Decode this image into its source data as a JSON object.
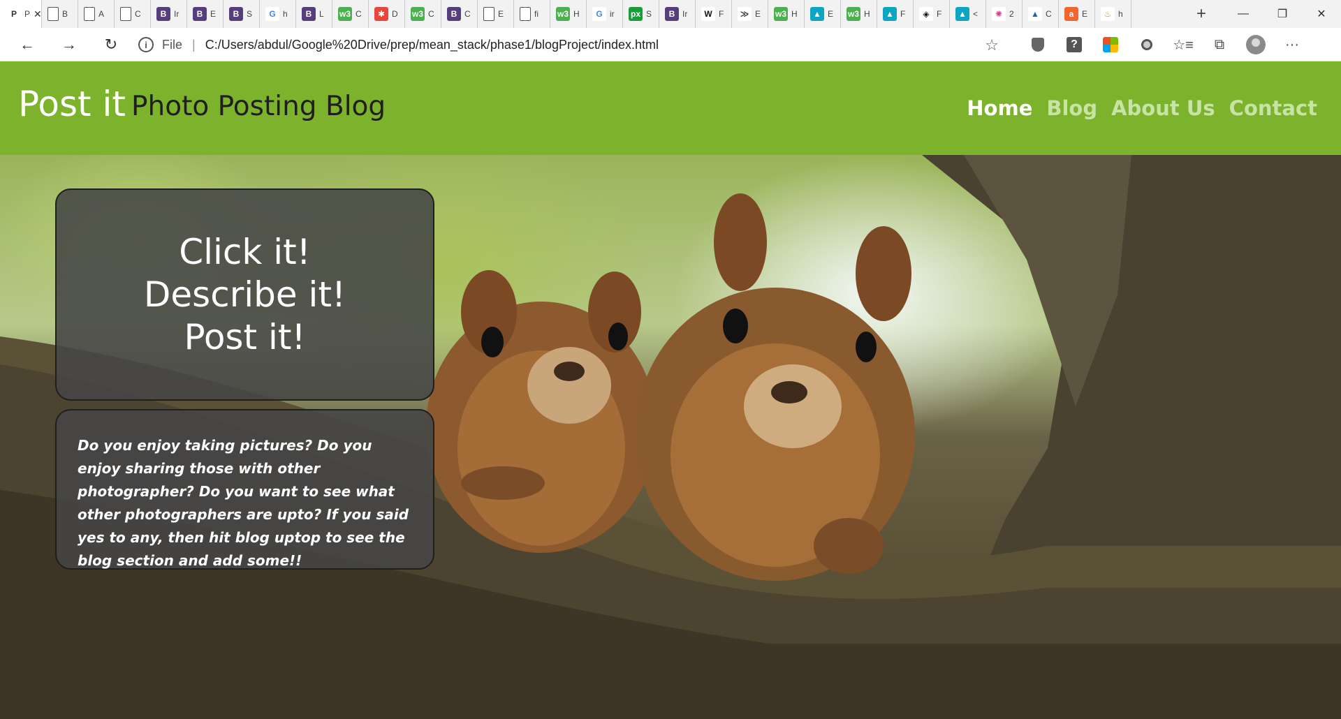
{
  "browser": {
    "tabs": [
      {
        "fav": "P",
        "label": "P",
        "bg": "#ffffff",
        "fg": "#333333",
        "active": true
      },
      {
        "fav": "doc-icon",
        "label": "B"
      },
      {
        "fav": "doc-icon",
        "label": "A"
      },
      {
        "fav": "doc-icon",
        "label": "C"
      },
      {
        "fav": "B",
        "label": "Ir",
        "bg": "#563d7c"
      },
      {
        "fav": "B",
        "label": "E",
        "bg": "#563d7c"
      },
      {
        "fav": "B",
        "label": "S",
        "bg": "#563d7c"
      },
      {
        "fav": "G",
        "label": "h",
        "bg": "#ffffff",
        "fg": "#4285f4"
      },
      {
        "fav": "B",
        "label": "L",
        "bg": "#563d7c"
      },
      {
        "fav": "w3",
        "label": "C",
        "bg": "#4caf50"
      },
      {
        "fav": "✱",
        "label": "D",
        "bg": "#e8453c"
      },
      {
        "fav": "w3",
        "label": "C",
        "bg": "#4caf50"
      },
      {
        "fav": "B",
        "label": "C",
        "bg": "#563d7c"
      },
      {
        "fav": "doc-icon",
        "label": "E"
      },
      {
        "fav": "doc-icon",
        "label": "fi"
      },
      {
        "fav": "w3",
        "label": "H",
        "bg": "#4caf50"
      },
      {
        "fav": "G",
        "label": "ir",
        "bg": "#ffffff",
        "fg": "#4285f4"
      },
      {
        "fav": "px",
        "label": "S",
        "bg": "#1a9c3b"
      },
      {
        "fav": "B",
        "label": "Ir",
        "bg": "#563d7c"
      },
      {
        "fav": "W",
        "label": "F",
        "bg": "#ffffff",
        "fg": "#111111"
      },
      {
        "fav": "≫",
        "label": "E",
        "bg": "#ffffff",
        "fg": "#333333"
      },
      {
        "fav": "w3",
        "label": "H",
        "bg": "#4caf50"
      },
      {
        "fav": "▲",
        "label": "E",
        "bg": "#0ea5c4"
      },
      {
        "fav": "w3",
        "label": "H",
        "bg": "#4caf50"
      },
      {
        "fav": "▲",
        "label": "F",
        "bg": "#0ea5c4"
      },
      {
        "fav": "◈",
        "label": "F",
        "bg": "#ffffff",
        "fg": "#111111"
      },
      {
        "fav": "▲",
        "label": "<",
        "bg": "#0ea5c4"
      },
      {
        "fav": "✺",
        "label": "2",
        "bg": "#ffffff",
        "fg": "#d33f8b"
      },
      {
        "fav": "▲",
        "label": "C",
        "bg": "#ffffff",
        "fg": "#1565c0"
      },
      {
        "fav": "a",
        "label": "E",
        "bg": "#f2652d"
      },
      {
        "fav": "♨",
        "label": "h",
        "bg": "#ffffff",
        "fg": "#f48024"
      }
    ],
    "new_tab": "+",
    "window_controls": {
      "minimize": "—",
      "restore": "❐",
      "close": "✕"
    },
    "nav": {
      "back": "←",
      "forward": "→",
      "reload": "↻"
    },
    "address": {
      "info_icon": "i",
      "scheme_label": "File",
      "separator": "|",
      "url": "C:/Users/abdul/Google%20Drive/prep/mean_stack/phase1/blogProject/index.html",
      "star": "☆"
    },
    "toolbar_icons": [
      "shield-icon",
      "help-icon",
      "office-icon",
      "circle-icon",
      "favorites-icon",
      "collections-icon",
      "profile-icon",
      "more-icon"
    ],
    "more_label": "···",
    "favorites_glyph": "☆≡",
    "collections_glyph": "⧉"
  },
  "site": {
    "brand": "Post it",
    "tagline": "Photo Posting Blog",
    "nav": [
      "Home",
      "Blog",
      "About Us",
      "Contact"
    ],
    "hero": {
      "lines": [
        "Click it!",
        "Describe it!",
        "Post it!"
      ],
      "description": "Do you enjoy taking pictures? Do you enjoy sharing those with other photographer? Do you want to see what other photographers are upto? If you said yes to any, then hit blog uptop to see the blog section and add some!!"
    },
    "colors": {
      "header": "#7db32c",
      "nav_active": "#ffffff",
      "nav_inactive": "#c7e3a5",
      "card": "#464646"
    }
  }
}
